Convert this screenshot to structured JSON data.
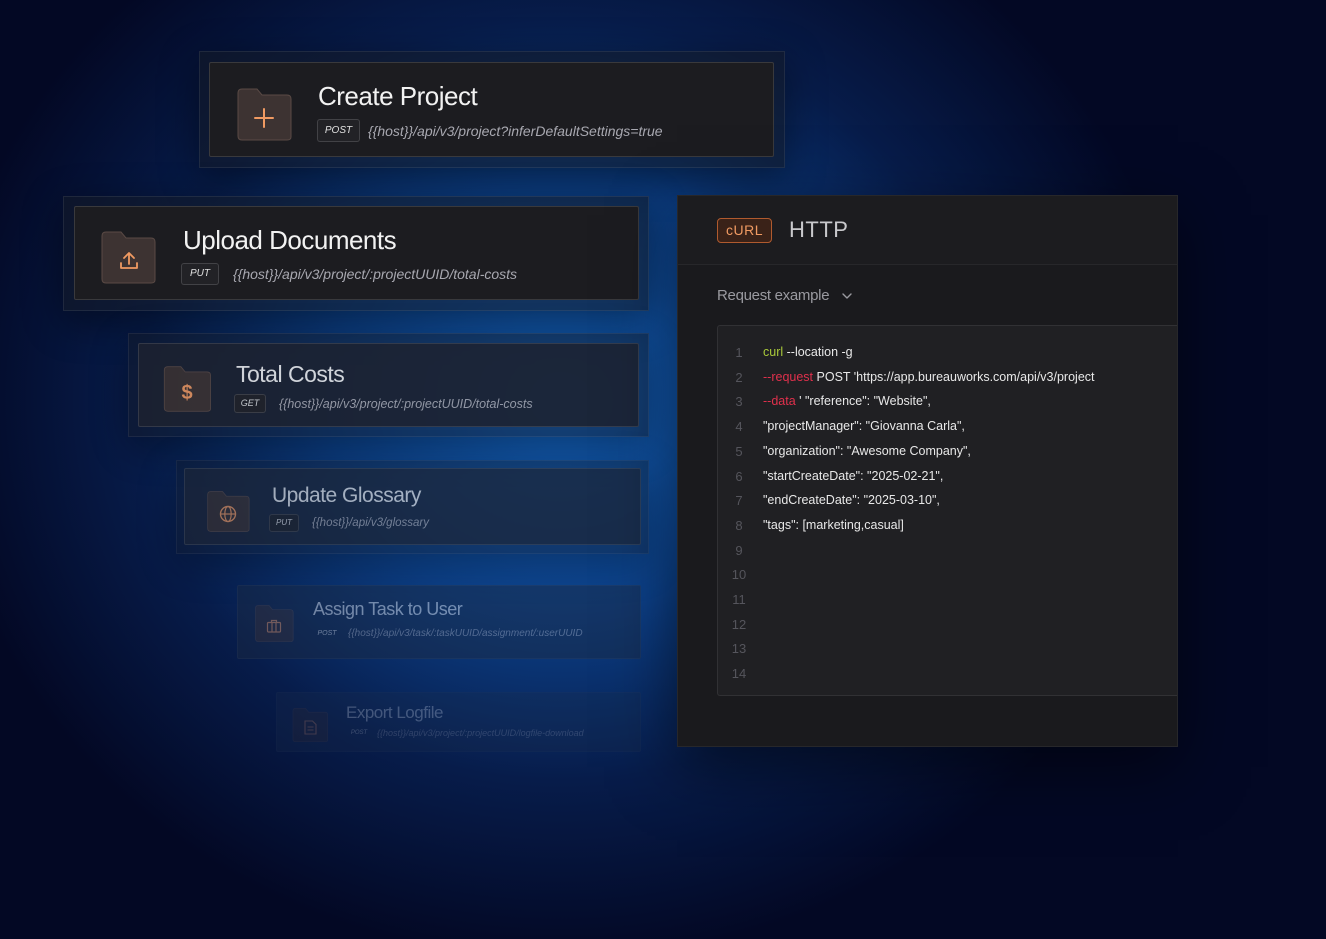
{
  "endpoints": [
    {
      "title": "Create Project",
      "method": "POST",
      "path": "{{host}}/api/v3/project?inferDefaultSettings=true",
      "icon": "plus-icon"
    },
    {
      "title": "Upload Documents",
      "method": "PUT",
      "path": "{{host}}/api/v3/project/:projectUUID/total-costs",
      "icon": "upload-icon"
    },
    {
      "title": "Total Costs",
      "method": "GET",
      "path": "{{host}}/api/v3/project/:projectUUID/total-costs",
      "icon": "dollar-icon"
    },
    {
      "title": "Update Glossary",
      "method": "PUT",
      "path": "{{host}}/api/v3/glossary",
      "icon": "globe-icon"
    },
    {
      "title": "Assign Task to User",
      "method": "POST",
      "path": "{{host}}/api/v3/task/:taskUUID/assignment/:userUUID",
      "icon": "briefcase-icon"
    },
    {
      "title": "Export Logfile",
      "method": "POST",
      "path": "{{host}}/api/v3/project/:projectUUID/logfile-download",
      "icon": "document-icon"
    }
  ],
  "code_panel": {
    "tabs": [
      "cURL",
      "HTTP"
    ],
    "request_label": "Request example",
    "lines": [
      {
        "n": "1",
        "parts": [
          {
            "t": "curl",
            "c": "green"
          },
          {
            "t": " --location -g",
            "c": ""
          }
        ]
      },
      {
        "n": "2",
        "parts": [
          {
            "t": "--request",
            "c": "red"
          },
          {
            "t": " POST 'https://app.bureauworks.com/api/v3/project",
            "c": ""
          }
        ]
      },
      {
        "n": "3",
        "parts": [
          {
            "t": "--data",
            "c": "red"
          },
          {
            "t": " ' \"reference\": \"Website\",",
            "c": ""
          }
        ]
      },
      {
        "n": "4",
        "parts": [
          {
            "t": "\"projectManager\": \"Giovanna Carla\",",
            "c": ""
          }
        ]
      },
      {
        "n": "5",
        "parts": [
          {
            "t": "\"organization\": \"Awesome Company\",",
            "c": ""
          }
        ]
      },
      {
        "n": "6",
        "parts": [
          {
            "t": "\"startCreateDate\": \"2025-02-21\",",
            "c": ""
          }
        ]
      },
      {
        "n": "7",
        "parts": [
          {
            "t": "\"endCreateDate\": \"2025-03-10\",",
            "c": ""
          }
        ]
      },
      {
        "n": "8",
        "parts": [
          {
            "t": "\"tags\": [marketing,casual]",
            "c": ""
          }
        ]
      },
      {
        "n": "9",
        "parts": []
      },
      {
        "n": "10",
        "parts": []
      },
      {
        "n": "11",
        "parts": []
      },
      {
        "n": "12",
        "parts": []
      },
      {
        "n": "13",
        "parts": []
      },
      {
        "n": "14",
        "parts": []
      }
    ]
  },
  "colors": {
    "accent": "#f09a62",
    "folder": "#3d3332",
    "keyword_green": "#a9c93a",
    "keyword_red": "#e0304c"
  }
}
